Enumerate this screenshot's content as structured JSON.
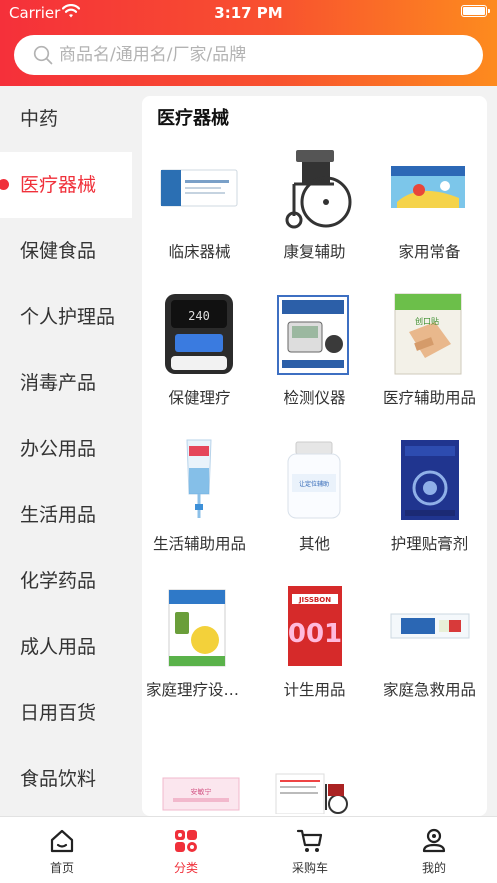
{
  "status_bar": {
    "carrier": "Carrier",
    "time": "3:17 PM"
  },
  "search": {
    "placeholder": "商品名/通用名/厂家/品牌"
  },
  "sidebar": {
    "items": [
      {
        "label": "中药",
        "active": false
      },
      {
        "label": "医疗器械",
        "active": true
      },
      {
        "label": "保健食品",
        "active": false
      },
      {
        "label": "个人护理品",
        "active": false
      },
      {
        "label": "消毒产品",
        "active": false
      },
      {
        "label": "办公用品",
        "active": false
      },
      {
        "label": "生活用品",
        "active": false
      },
      {
        "label": "化学药品",
        "active": false
      },
      {
        "label": "成人用品",
        "active": false
      },
      {
        "label": "日用百货",
        "active": false
      },
      {
        "label": "食品饮料",
        "active": false
      }
    ]
  },
  "panel": {
    "title": "医疗器械",
    "items": [
      {
        "label": "临床器械",
        "icon": "medical-box-image"
      },
      {
        "label": "康复辅助",
        "icon": "wheelchair-image"
      },
      {
        "label": "家用常备",
        "icon": "kids-patch-box-image"
      },
      {
        "label": "保健理疗",
        "icon": "therapy-device-image"
      },
      {
        "label": "检测仪器",
        "icon": "blood-pressure-monitor-image"
      },
      {
        "label": "医疗辅助用品",
        "icon": "bandage-box-image"
      },
      {
        "label": "生活辅助用品",
        "icon": "liquid-bag-image"
      },
      {
        "label": "其他",
        "icon": "supplement-bottle-image"
      },
      {
        "label": "护理贴膏剂",
        "icon": "plaster-box-image"
      },
      {
        "label": "家庭理疗设备...",
        "icon": "therapy-kit-image"
      },
      {
        "label": "计生用品",
        "icon": "condom-box-image"
      },
      {
        "label": "家庭急救用品",
        "icon": "first-aid-strip-image"
      },
      {
        "label": "",
        "icon": "pink-package-image"
      },
      {
        "label": "",
        "icon": "wheelchair-leaflet-image"
      }
    ]
  },
  "tabbar": {
    "tabs": [
      {
        "label": "首页",
        "icon": "home-icon",
        "active": false
      },
      {
        "label": "分类",
        "icon": "category-grid-icon",
        "active": true
      },
      {
        "label": "采购车",
        "icon": "cart-icon",
        "active": false
      },
      {
        "label": "我的",
        "icon": "profile-icon",
        "active": false
      }
    ]
  },
  "colors": {
    "accent": "#f0303a",
    "header_start": "#f5303a",
    "header_end": "#fd8b1e"
  }
}
